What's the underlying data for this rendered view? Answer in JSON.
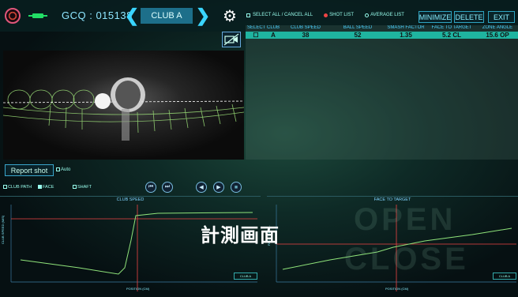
{
  "topbar": {
    "gcq_label": "GCQ : 015138",
    "club_selected": "CLUB A",
    "select_all_label": "SELECT ALL / CANCEL ALL",
    "shot_list_label": "SHOT LIST",
    "average_list_label": "AVERAGE LIST",
    "minimize_label": "MINIMIZE",
    "delete_label": "DELETE",
    "exit_label": "EXIT"
  },
  "table": {
    "headers": [
      "SELECT",
      "CLUB",
      "CLUB SPEED",
      "BALL SPEED",
      "SMASH FACTOR",
      "FACE TO TARGET",
      "ZONE ANGLE"
    ],
    "rows": [
      {
        "select": "☐",
        "club": "A",
        "club_speed": "38",
        "ball_speed": "52",
        "smash_factor": "1.35",
        "face_to_target": "5.2 CL",
        "zone_angle": "15.6 OP"
      }
    ]
  },
  "controls": {
    "report_shot_label": "Report shot",
    "auto_label": "Auto",
    "club_path_label": "CLUB PATH",
    "face_label": "FACE",
    "shaft_label": "SHAFT"
  },
  "graphs": {
    "left": {
      "title": "CLUB SPEED",
      "ylabel": "CLUB SPEED (M/S)",
      "xlabel": "POSITION (CM)",
      "legend": "CLUB A"
    },
    "right": {
      "title": "FACE TO TARGET",
      "ylabel": "FACE TO TA...",
      "xlabel": "POSITION (CM)",
      "legend": "CLUB A"
    }
  },
  "overlay": {
    "caption": "計測画面",
    "open_text": "OPEN",
    "close_text": "CLOSE"
  },
  "colors": {
    "accent": "#3ad5ff",
    "row_highlight": "#1fb4a0",
    "curve": "#8fe37a"
  }
}
